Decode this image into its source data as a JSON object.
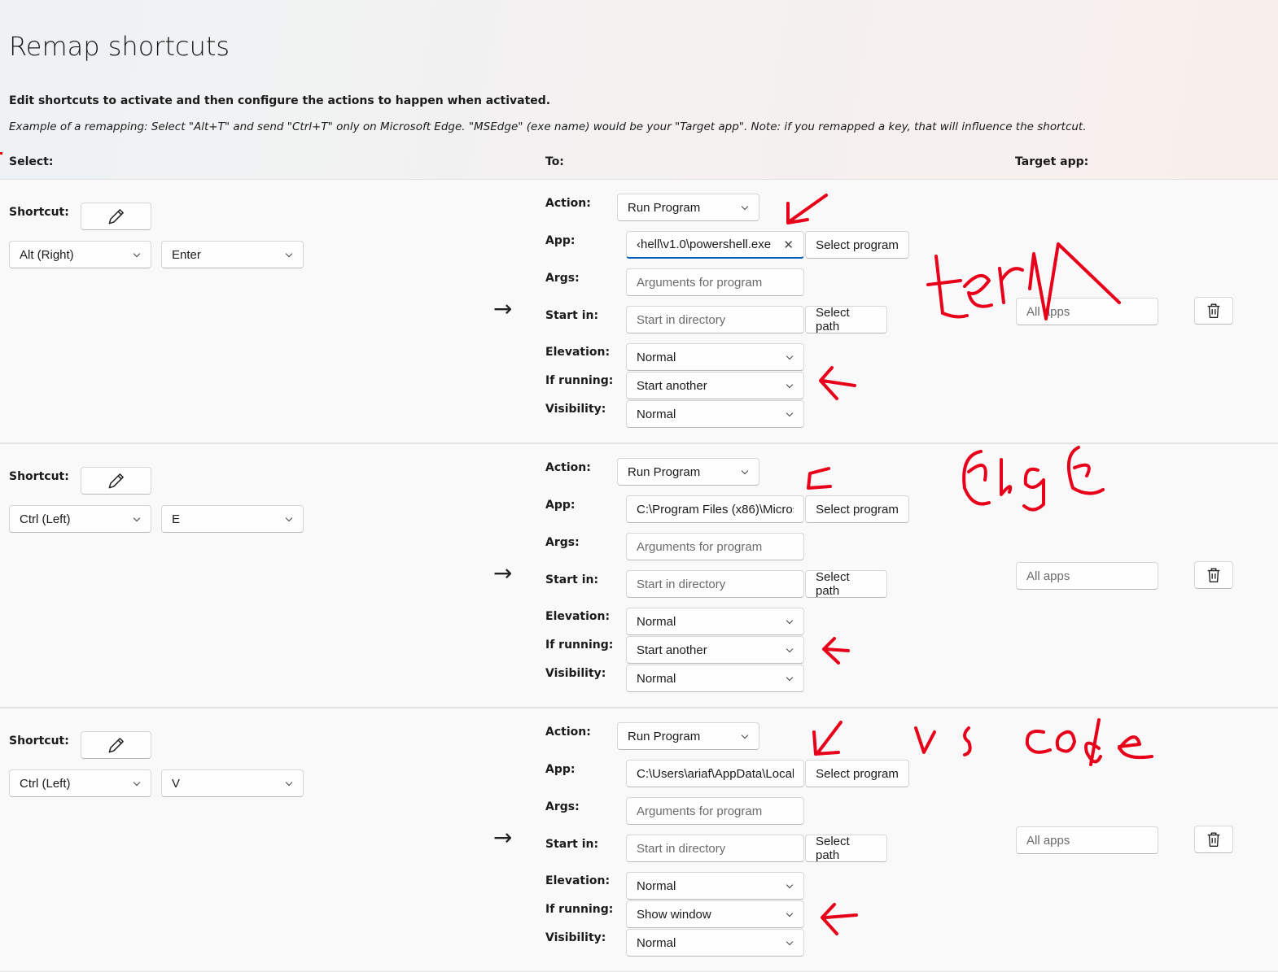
{
  "header": {
    "title": "Remap shortcuts",
    "description": "Edit shortcuts to activate and then configure the actions to happen when activated.",
    "example": "Example of a remapping: Select \"Alt+T\" and send \"Ctrl+T\" only on Microsoft Edge. \"MSEdge\" (exe name) would be your \"Target app\". Note: if you remapped a key, that will influence the shortcut.",
    "col_select": "Select:",
    "col_to": "To:",
    "col_target": "Target app:"
  },
  "labels": {
    "shortcut": "Shortcut:",
    "action": "Action:",
    "app": "App:",
    "args": "Args:",
    "start_in": "Start in:",
    "elevation": "Elevation:",
    "if_running": "If running:",
    "visibility": "Visibility:",
    "select_program": "Select program",
    "select_path": "Select path",
    "args_placeholder": "Arguments for program",
    "start_placeholder": "Start in directory",
    "target_placeholder": "All apps"
  },
  "rows": [
    {
      "modifier": "Alt (Right)",
      "key": "Enter",
      "action": "Run Program",
      "app": "‹hell\\v1.0\\powershell.exe",
      "elevation": "Normal",
      "if_running": "Start another",
      "visibility": "Normal",
      "annotation": "term"
    },
    {
      "modifier": "Ctrl (Left)",
      "key": "E",
      "action": "Run Program",
      "app": "C:\\Program Files (x86)\\Micros",
      "elevation": "Normal",
      "if_running": "Start another",
      "visibility": "Normal",
      "annotation": "edge"
    },
    {
      "modifier": "Ctrl (Left)",
      "key": "V",
      "action": "Run Program",
      "app": "C:\\Users\\ariaf\\AppData\\Local",
      "elevation": "Normal",
      "if_running": "Show window",
      "visibility": "Normal",
      "annotation": "vs code"
    }
  ],
  "icons": {
    "pencil": "pencil-icon",
    "arrow": "arrow-right-icon",
    "trash": "trash-icon",
    "chevron": "chevron-down-icon",
    "clear": "close-icon"
  },
  "colors": {
    "ink": "#e8001a",
    "focus": "#005fb8"
  }
}
